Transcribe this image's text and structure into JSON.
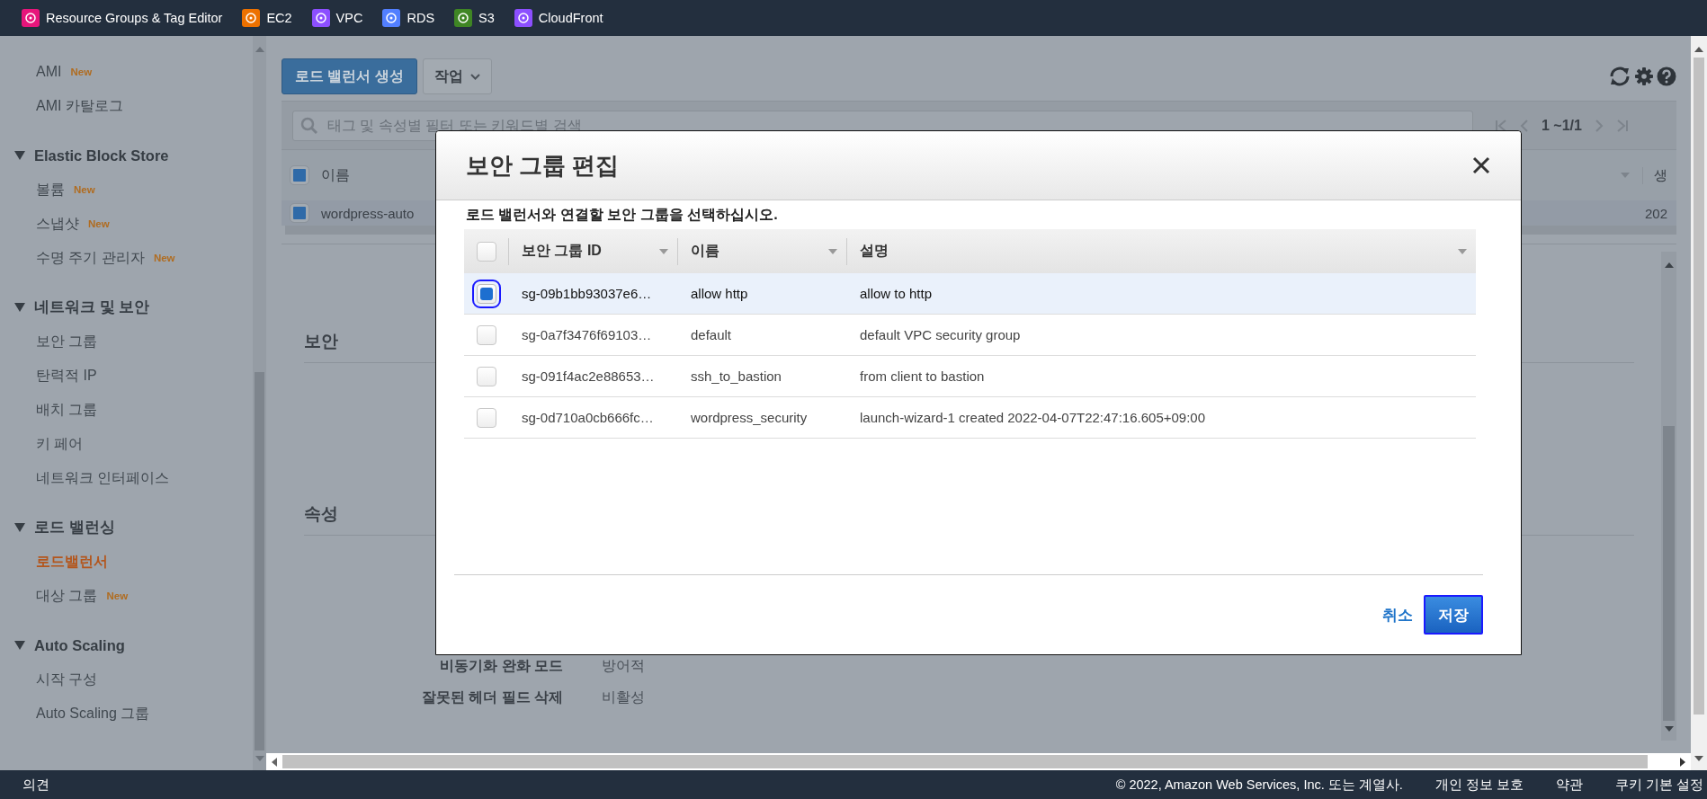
{
  "top_bar": {
    "services": [
      {
        "label": "Resource Groups & Tag Editor",
        "color": "#e7157b"
      },
      {
        "label": "EC2",
        "color": "#ed7100"
      },
      {
        "label": "VPC",
        "color": "#8c4fff"
      },
      {
        "label": "RDS",
        "color": "#527fff"
      },
      {
        "label": "S3",
        "color": "#3f8624"
      },
      {
        "label": "CloudFront",
        "color": "#8c4fff"
      }
    ]
  },
  "sidebar": {
    "sections": [
      {
        "items": [
          {
            "label": "AMI",
            "badge": "New",
            "selected": false
          },
          {
            "label": "AMI 카탈로그",
            "selected": false
          }
        ]
      },
      {
        "title": "Elastic Block Store",
        "expanded": true,
        "items": [
          {
            "label": "볼륨",
            "badge": "New",
            "selected": false
          },
          {
            "label": "스냅샷",
            "badge": "New",
            "selected": false
          },
          {
            "label": "수명 주기 관리자",
            "badge": "New",
            "selected": false
          }
        ]
      },
      {
        "title": "네트워크 및 보안",
        "expanded": true,
        "items": [
          {
            "label": "보안 그룹",
            "selected": false
          },
          {
            "label": "탄력적 IP",
            "selected": false
          },
          {
            "label": "배치 그룹",
            "selected": false
          },
          {
            "label": "키 페어",
            "selected": false
          },
          {
            "label": "네트워크 인터페이스",
            "selected": false
          }
        ]
      },
      {
        "title": "로드 밸런싱",
        "expanded": true,
        "items": [
          {
            "label": "로드밸런서",
            "selected": true
          },
          {
            "label": "대상 그룹",
            "badge": "New",
            "selected": false
          }
        ]
      },
      {
        "title": "Auto Scaling",
        "expanded": true,
        "items": [
          {
            "label": "시작 구성",
            "selected": false
          },
          {
            "label": "Auto Scaling 그룹",
            "selected": false
          }
        ]
      }
    ]
  },
  "toolbar": {
    "create_button": "로드 밸런서 생성",
    "actions_button": "작업"
  },
  "filter": {
    "placeholder": "태그 및 속성별 필터 또는 키워드별 검색",
    "pagination": "1 ~1/1"
  },
  "table": {
    "all_checked": true,
    "columns": [
      "이름",
      "생"
    ],
    "rows": [
      {
        "cells": [
          "wordpress-auto",
          "202"
        ],
        "checked": true
      }
    ]
  },
  "detail": {
    "headings": [
      "보안",
      "속성"
    ],
    "attributes": [
      {
        "label": "비동기화 완화 모드",
        "value": "방어적"
      },
      {
        "label": "잘못된 헤더 필드 삭제",
        "value": "비활성"
      }
    ]
  },
  "modal": {
    "title": "보안 그룹 편집",
    "instruction": "로드 밸런서와 연결할 보안 그룹을 선택하십시오.",
    "all_selected": false,
    "columns": [
      "보안 그룹 ID",
      "이름",
      "설명"
    ],
    "rows": [
      {
        "id": "sg-09b1bb93037e6…",
        "name": "allow http",
        "description": "allow to http",
        "selected": true
      },
      {
        "id": "sg-0a7f3476f69103…",
        "name": "default",
        "description": "default VPC security group",
        "selected": false
      },
      {
        "id": "sg-091f4ac2e88653…",
        "name": "ssh_to_bastion",
        "description": "from client to bastion",
        "selected": false
      },
      {
        "id": "sg-0d710a0cb666fc…",
        "name": "wordpress_security",
        "description": "launch-wizard-1 created 2022-04-07T22:47:16.605+09:00",
        "selected": false
      }
    ],
    "cancel": "취소",
    "save": "저장"
  },
  "footer": {
    "feedback": "의견",
    "copyright": "© 2022, Amazon Web Services, Inc. 또는 계열사.",
    "links": [
      "개인 정보 보호",
      "약관",
      "쿠키 기본 설정"
    ]
  }
}
